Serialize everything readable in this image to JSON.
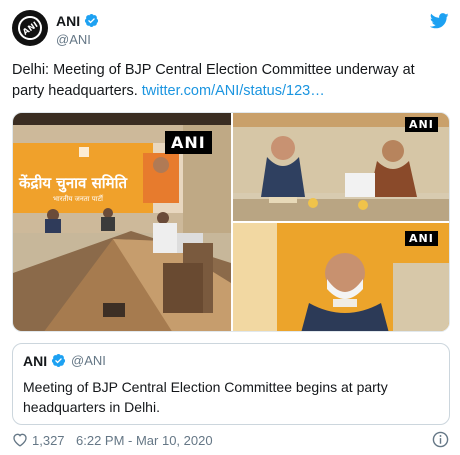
{
  "author": {
    "name": "ANI",
    "handle": "@ANI",
    "avatar_text": "ANI"
  },
  "tweet": {
    "text": "Delhi: Meeting of BJP Central Election Committee underway at party headquarters.",
    "link": "twitter.com/ANI/status/123…"
  },
  "media": {
    "badge": "ANI",
    "banner_text": "केंद्रीय चुनाव समिति",
    "banner_small_text": "भारतीय जनता पार्टी",
    "colors": {
      "saffron": "#f0a12b",
      "wall": "#d9c9ab",
      "table": "#9a6a3e"
    }
  },
  "quote": {
    "name": "ANI",
    "handle": "@ANI",
    "text": "Meeting of BJP Central Election Committee begins at party headquarters in Delhi."
  },
  "footer": {
    "likes": "1,327",
    "timestamp": "6:22 PM - Mar 10, 2020"
  },
  "icons": [
    "twitter-bird-icon",
    "verified-badge-icon",
    "heart-icon",
    "info-icon"
  ],
  "colors": {
    "link": "#1b95e0",
    "muted": "#657786",
    "text": "#14171a",
    "twitter_blue": "#1da1f2"
  }
}
